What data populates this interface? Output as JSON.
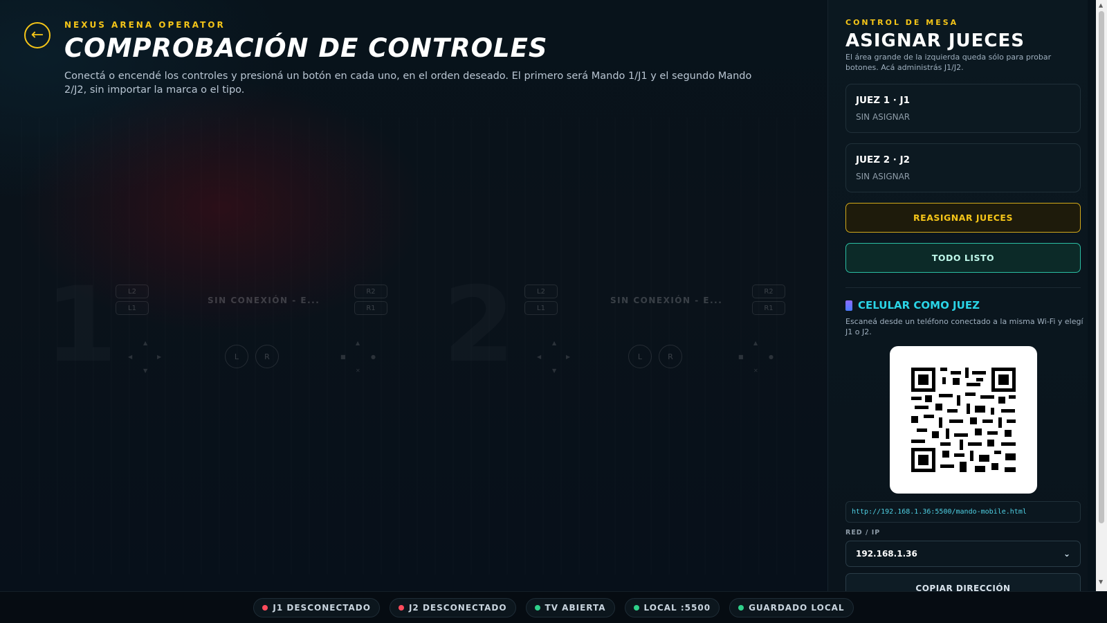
{
  "header": {
    "back_glyph": "←",
    "kicker": "NEXUS ARENA OPERATOR",
    "title": "COMPROBACIÓN DE CONTROLES",
    "description": "Conectá o encendé los controles y presioná un botón en cada uno, en el orden deseado. El primero será Mando 1/J1 y el segundo Mando 2/J2, sin importar la marca o el tipo."
  },
  "controllers": [
    {
      "number": "1",
      "status": "SIN CONEXIÓN - E...",
      "left_shoulders": [
        "L2",
        "L1"
      ],
      "right_shoulders": [
        "R2",
        "R1"
      ],
      "sticks": [
        "L",
        "R"
      ]
    },
    {
      "number": "2",
      "status": "SIN CONEXIÓN - E...",
      "left_shoulders": [
        "L2",
        "L1"
      ],
      "right_shoulders": [
        "R2",
        "R1"
      ],
      "sticks": [
        "L",
        "R"
      ]
    }
  ],
  "side": {
    "kicker": "CONTROL DE MESA",
    "title": "ASIGNAR JUECES",
    "description": "El área grande de la izquierda queda sólo para probar botones. Acá administrás J1/J2.",
    "judges": [
      {
        "name": "JUEZ 1 · J1",
        "state": "SIN ASIGNAR"
      },
      {
        "name": "JUEZ 2 · J2",
        "state": "SIN ASIGNAR"
      }
    ],
    "reassign_label": "REASIGNAR JUECES",
    "ready_label": "TODO LISTO",
    "phone_title": "CELULAR COMO JUEZ",
    "phone_description": "Escaneá desde un teléfono conectado a la misma Wi-Fi y elegí J1 o J2.",
    "url": "http://192.168.1.36:5500/mando-mobile.html",
    "ip_label": "RED / IP",
    "ip_value": "192.168.1.36",
    "copy_label": "COPIAR DIRECCIÓN"
  },
  "footer": {
    "chips": [
      {
        "label": "J1 DESCONECTADO",
        "color": "#ff4b5c"
      },
      {
        "label": "J2 DESCONECTADO",
        "color": "#ff4b5c"
      },
      {
        "label": "TV ABIERTA",
        "color": "#2fd08a"
      },
      {
        "label": "LOCAL :5500",
        "color": "#2fd08a"
      },
      {
        "label": "GUARDADO LOCAL",
        "color": "#2fd08a"
      }
    ]
  },
  "colors": {
    "accent_yellow": "#f5c518",
    "accent_cyan": "#2ad4e6",
    "accent_teal": "#2bbfa4",
    "status_red": "#ff4b5c",
    "status_green": "#2fd08a"
  }
}
